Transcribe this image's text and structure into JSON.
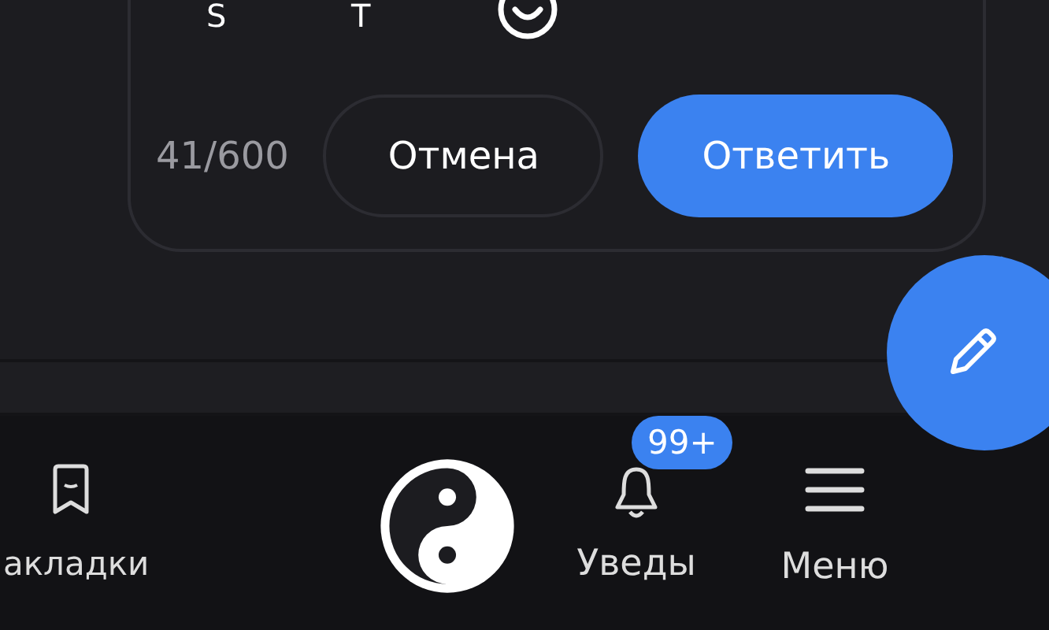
{
  "format_toolbar": [
    {
      "kind": "text",
      "label": "S"
    },
    {
      "kind": "text",
      "label": "T"
    },
    {
      "kind": "emoji"
    }
  ],
  "reply_form": {
    "counter": "41/600",
    "cancel_button": "Отмена",
    "submit_button": "Ответить"
  },
  "fab": {
    "kind": "edit"
  },
  "bottom_nav": [
    {
      "kind": "bookmark",
      "label": "акладки",
      "selected": false
    },
    {
      "kind": "logo",
      "selected": false
    },
    {
      "kind": "bell",
      "label": "Уведы",
      "badge": "99+",
      "selected": false
    },
    {
      "kind": "menu",
      "label": "Меню",
      "selected": false
    }
  ]
}
